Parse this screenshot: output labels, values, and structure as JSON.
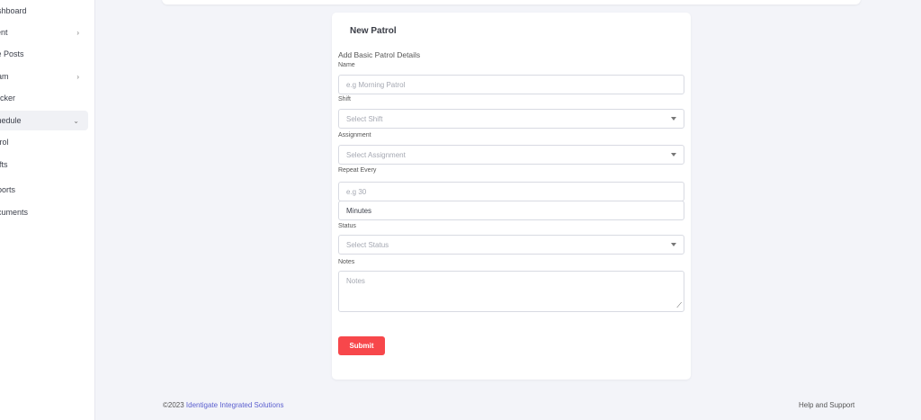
{
  "sidebar": {
    "items": [
      {
        "label": "ashboard",
        "chevron": ""
      },
      {
        "label": "lient",
        "chevron": "›"
      },
      {
        "label": "ite Posts",
        "chevron": ""
      },
      {
        "label": "eam",
        "chevron": "›"
      },
      {
        "label": "racker",
        "chevron": ""
      },
      {
        "label": "chedule",
        "chevron": "⌄"
      },
      {
        "label": "atrol",
        "chevron": ""
      },
      {
        "label": "hifts",
        "chevron": ""
      },
      {
        "label": "eports",
        "chevron": ""
      },
      {
        "label": "ocuments",
        "chevron": ""
      }
    ]
  },
  "form": {
    "title": "New Patrol",
    "subtitle": "Add Basic Patrol Details",
    "name_label": "Name",
    "name_placeholder": "e.g Morning Patrol",
    "shift_label": "Shift",
    "shift_value": "Select Shift",
    "assignment_label": "Assignment",
    "assignment_value": "Select Assignment",
    "repeat_label": "Repeat Every",
    "repeat_placeholder": "e.g 30",
    "repeat_unit": "Minutes",
    "status_label": "Status",
    "status_value": "Select Status",
    "notes_label": "Notes",
    "notes_placeholder": "Notes",
    "submit_label": "Submit"
  },
  "footer": {
    "copyright": "©2023 ",
    "company": "Identigate Integrated Solutions",
    "help": "Help and Support"
  },
  "colors": {
    "accent": "#f7474b",
    "link": "#5b5fcf",
    "background": "#f3f4f9"
  }
}
